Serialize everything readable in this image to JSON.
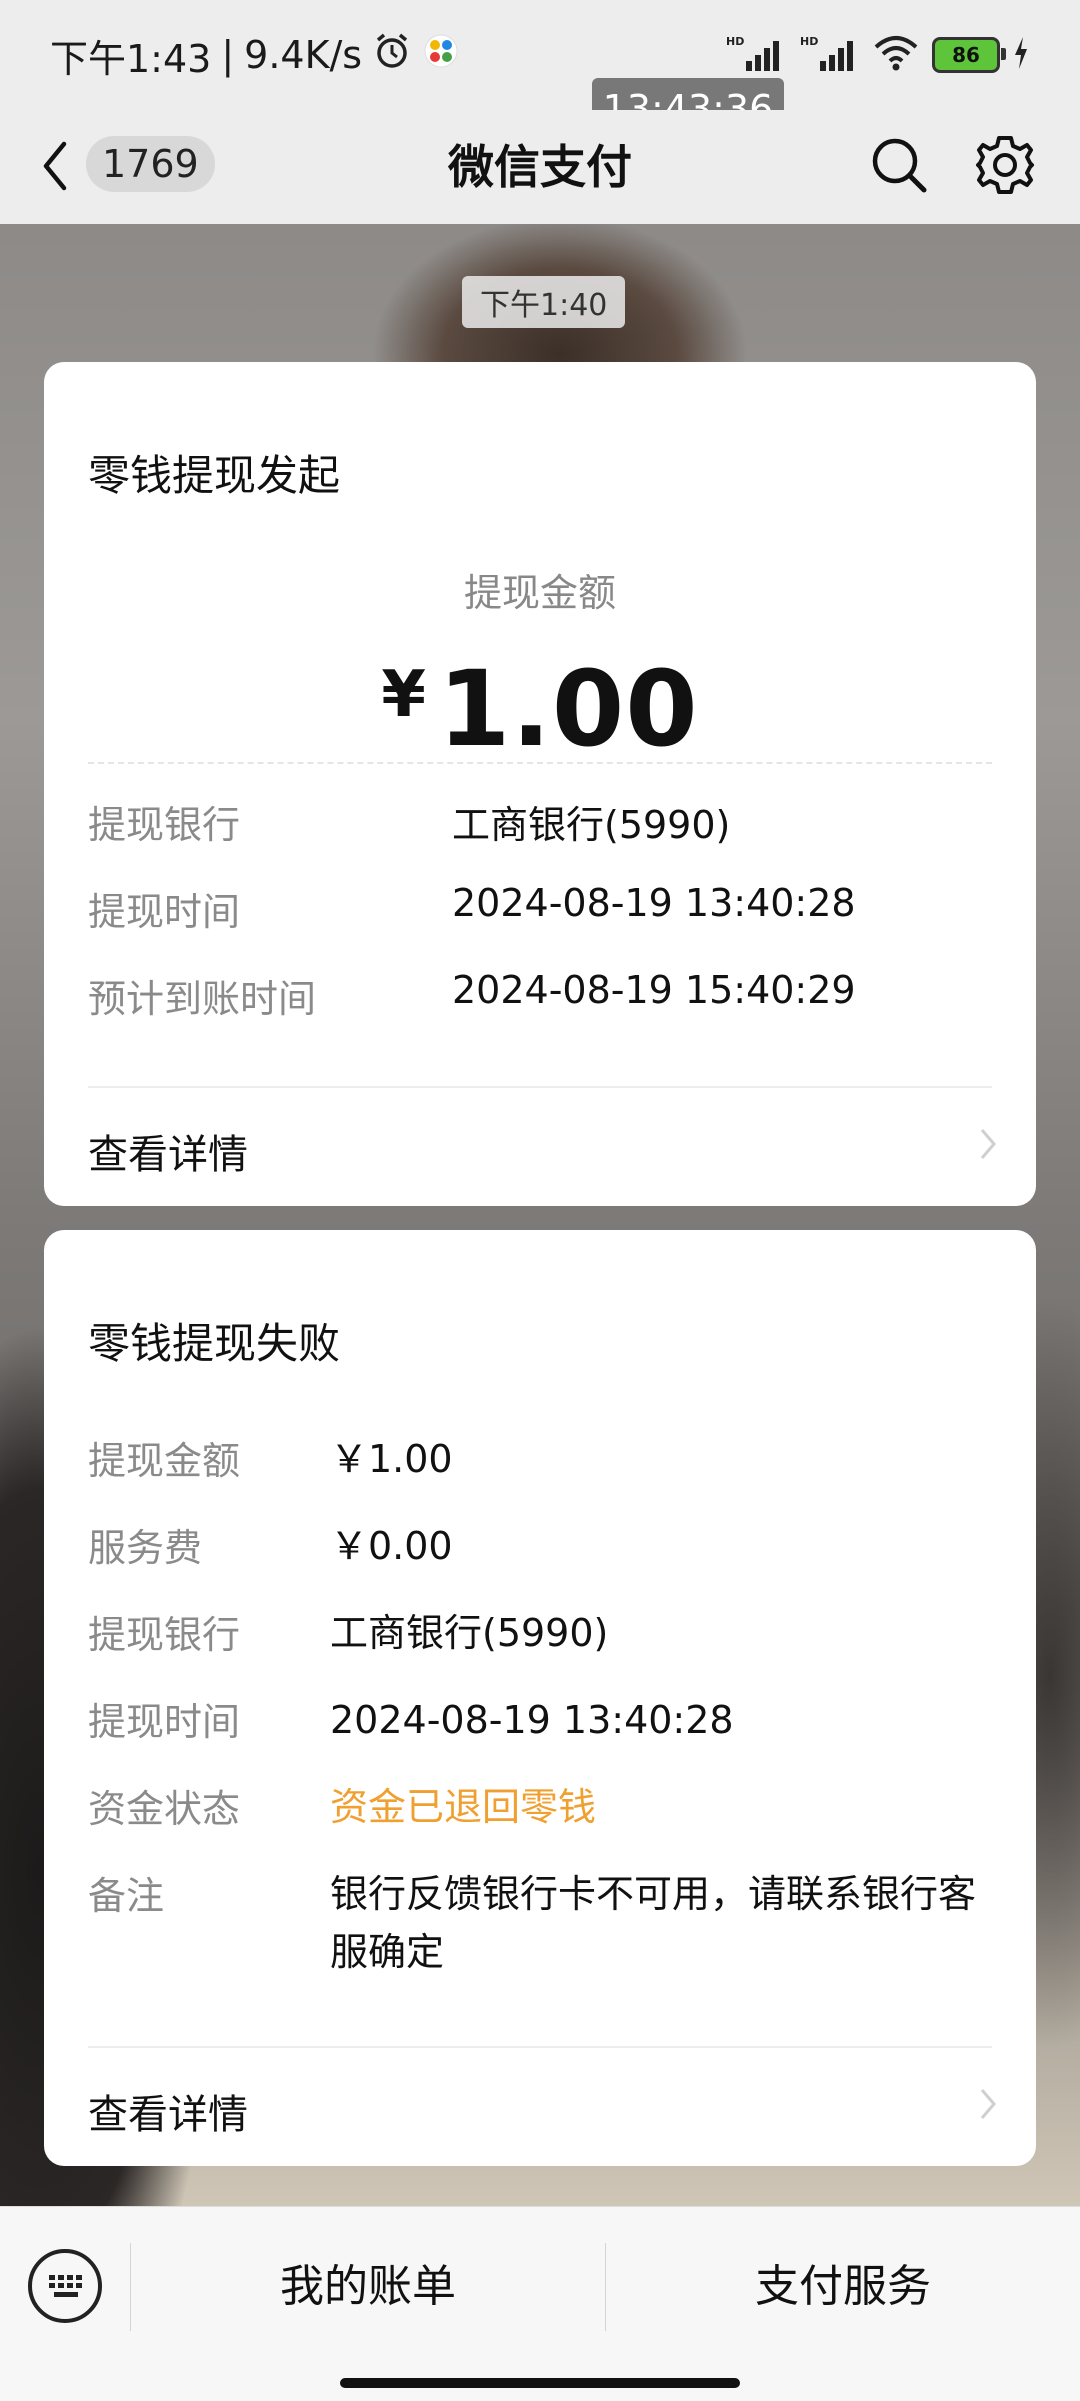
{
  "status_bar": {
    "time": "下午1:43",
    "separator": "|",
    "net_speed": "9.4K/s",
    "signal_hd_1": "HD",
    "signal_hd_2": "HD",
    "battery": "86"
  },
  "time_overlay": "13:43:36",
  "header": {
    "back_badge": "1769",
    "title": "微信支付"
  },
  "chat": {
    "timestamp": "下午1:40"
  },
  "card1": {
    "title": "零钱提现发起",
    "amount_label": "提现金额",
    "currency": "¥",
    "amount": "1.00",
    "rows": [
      {
        "label": "提现银行",
        "value": "工商银行(5990)"
      },
      {
        "label": "提现时间",
        "value": "2024-08-19 13:40:28"
      },
      {
        "label": "预计到账时间",
        "value": "2024-08-19 15:40:29"
      }
    ],
    "detail_link": "查看详情"
  },
  "card2": {
    "title": "零钱提现失败",
    "rows": [
      {
        "label": "提现金额",
        "value": "￥1.00"
      },
      {
        "label": "服务费",
        "value": "￥0.00"
      },
      {
        "label": "提现银行",
        "value": "工商银行(5990)"
      },
      {
        "label": "提现时间",
        "value": "2024-08-19 13:40:28"
      },
      {
        "label": "资金状态",
        "value": "资金已退回零钱"
      },
      {
        "label": "备注",
        "value": "银行反馈银行卡不可用，请联系银行客服确定"
      }
    ],
    "status_color": "#f0a030",
    "detail_link": "查看详情"
  },
  "bottom_bar": {
    "menu1": "我的账单",
    "menu2": "支付服务"
  },
  "icons": {
    "alarm": "alarm-icon",
    "app": "app-icon",
    "signal": "signal-icon",
    "wifi": "wifi-icon",
    "charging": "charging-icon",
    "back": "chevron-left-icon",
    "search": "search-icon",
    "settings": "gear-icon",
    "keyboard": "keyboard-icon",
    "chevron_right": "chevron-right-icon"
  }
}
